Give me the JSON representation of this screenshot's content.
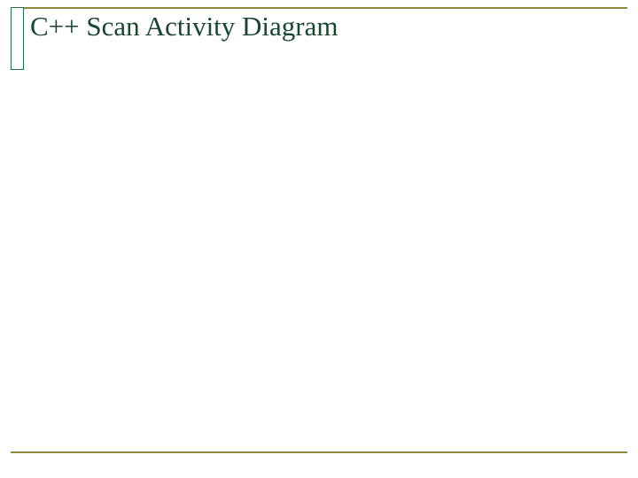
{
  "slide": {
    "title": "C++ Scan Activity Diagram",
    "colors": {
      "rule_line": "#8a8a3a",
      "accent_border": "#2e6b4a",
      "title_color": "#1a4530"
    }
  }
}
